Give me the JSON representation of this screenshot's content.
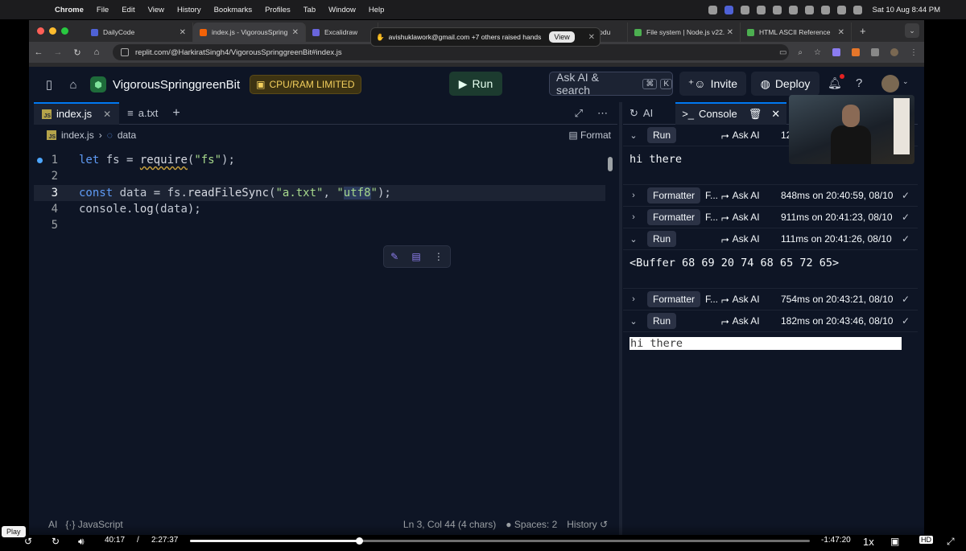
{
  "os_menubar": {
    "app": "Chrome",
    "menus": [
      "File",
      "Edit",
      "View",
      "History",
      "Bookmarks",
      "Profiles",
      "Tab",
      "Window",
      "Help"
    ],
    "clock": "Sat 10 Aug  8:44 PM"
  },
  "browser": {
    "tabs": [
      {
        "title": "DailyCode",
        "color": "#4f62d6"
      },
      {
        "title": "index.js - VigorousSpring",
        "color": "#f26207"
      },
      {
        "title": "Excalidraw",
        "color": "#6965db"
      },
      {
        "title": "ystem Modu",
        "color": "#888888"
      },
      {
        "title": "File system | Node.js v22.",
        "color": "#4caf50"
      },
      {
        "title": "HTML ASCII Reference",
        "color": "#4caf50"
      }
    ],
    "notification": {
      "text": "avishuklawork@gmail.com +7 others raised hands",
      "button": "View"
    },
    "url": "replit.com/@HarkiratSingh4/VigorousSpringgreenBit#index.js"
  },
  "replit": {
    "repl_name": "VigorousSpringgreenBit",
    "cpu_badge": "CPU/RAM LIMITED",
    "run_label": "Run",
    "search_label": "Ask AI & search",
    "search_kbd": [
      "⌘",
      "K"
    ],
    "invite_label": "Invite",
    "deploy_label": "Deploy"
  },
  "editor": {
    "tabs": [
      {
        "label": "index.js",
        "active": true
      },
      {
        "label": "a.txt",
        "active": false
      }
    ],
    "breadcrumb_file": "index.js",
    "breadcrumb_symbol": "data",
    "format_label": "Format",
    "lines": [
      {
        "num": "1",
        "text": "let fs = require(\"fs\");"
      },
      {
        "num": "2",
        "text": ""
      },
      {
        "num": "3",
        "text": "const data = fs.readFileSync(\"a.txt\", \"utf8\");"
      },
      {
        "num": "4",
        "text": "console.log(data);"
      },
      {
        "num": "5",
        "text": ""
      }
    ],
    "status": {
      "ai": "AI",
      "language": "JavaScript",
      "cursor": "Ln 3, Col 44 (4 chars)",
      "spaces": "Spaces: 2",
      "history": "History"
    }
  },
  "console": {
    "tabs": [
      {
        "label": "AI",
        "active": false
      },
      {
        "label": "Console",
        "active": true
      }
    ],
    "entries": [
      {
        "type": "Run",
        "expanded": true,
        "meta": "12",
        "output": "hi there"
      },
      {
        "type": "Formatter",
        "file": "F...",
        "expanded": false,
        "meta": "848ms on 20:40:59, 08/10"
      },
      {
        "type": "Formatter",
        "file": "F...",
        "expanded": false,
        "meta": "911ms on 20:41:23, 08/10"
      },
      {
        "type": "Run",
        "expanded": true,
        "meta": "111ms on 20:41:26, 08/10",
        "output": "<Buffer 68 69 20 74 68 65 72 65>"
      },
      {
        "type": "Formatter",
        "file": "F...",
        "expanded": false,
        "meta": "754ms on 20:43:21, 08/10"
      },
      {
        "type": "Run",
        "expanded": true,
        "meta": "182ms on 20:43:46, 08/10",
        "output": "hi there"
      }
    ],
    "ask_ai_label": "Ask AI"
  },
  "player": {
    "tooltip": "Play",
    "current_time": "40:17",
    "separator": "/",
    "duration": "2:27:37",
    "remaining": "-1:47:20",
    "speed": "1x",
    "progress_fraction": 0.273
  }
}
